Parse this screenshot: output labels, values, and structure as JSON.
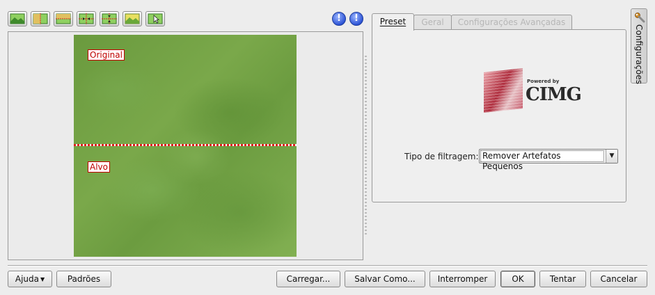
{
  "toolbar": {
    "buttons": [
      {
        "icon": "image-original-icon"
      },
      {
        "icon": "split-vertical-icon"
      },
      {
        "icon": "split-horizontal-icon"
      },
      {
        "icon": "compare-vertical-icon"
      },
      {
        "icon": "compare-horizontal-icon"
      },
      {
        "icon": "image-target-icon"
      },
      {
        "icon": "image-pointer-icon"
      }
    ],
    "info_icons": [
      "info-icon",
      "info-alt-icon"
    ]
  },
  "preview": {
    "original_label": "Original",
    "target_label": "Alvo"
  },
  "tabs": [
    {
      "label": "Preset",
      "active": true
    },
    {
      "label": "Geral",
      "active": false
    },
    {
      "label": "Configurações Avançadas",
      "active": false
    }
  ],
  "preset_panel": {
    "logo_powered_by": "Powered by",
    "logo_name": "CIMG",
    "filter_type_label": "Tipo de filtragem:",
    "filter_type_value": "Remover Artefatos Pequenos"
  },
  "dock": {
    "label": "Configurações",
    "icon": "wrench-icon"
  },
  "buttons": {
    "help": "Ajuda",
    "defaults": "Padrões",
    "load": "Carregar...",
    "save_as": "Salvar Como...",
    "abort": "Interromper",
    "ok": "OK",
    "try": "Tentar",
    "cancel": "Cancelar"
  },
  "colors": {
    "label_red": "#c00000",
    "info_blue": "#2e55d6"
  }
}
